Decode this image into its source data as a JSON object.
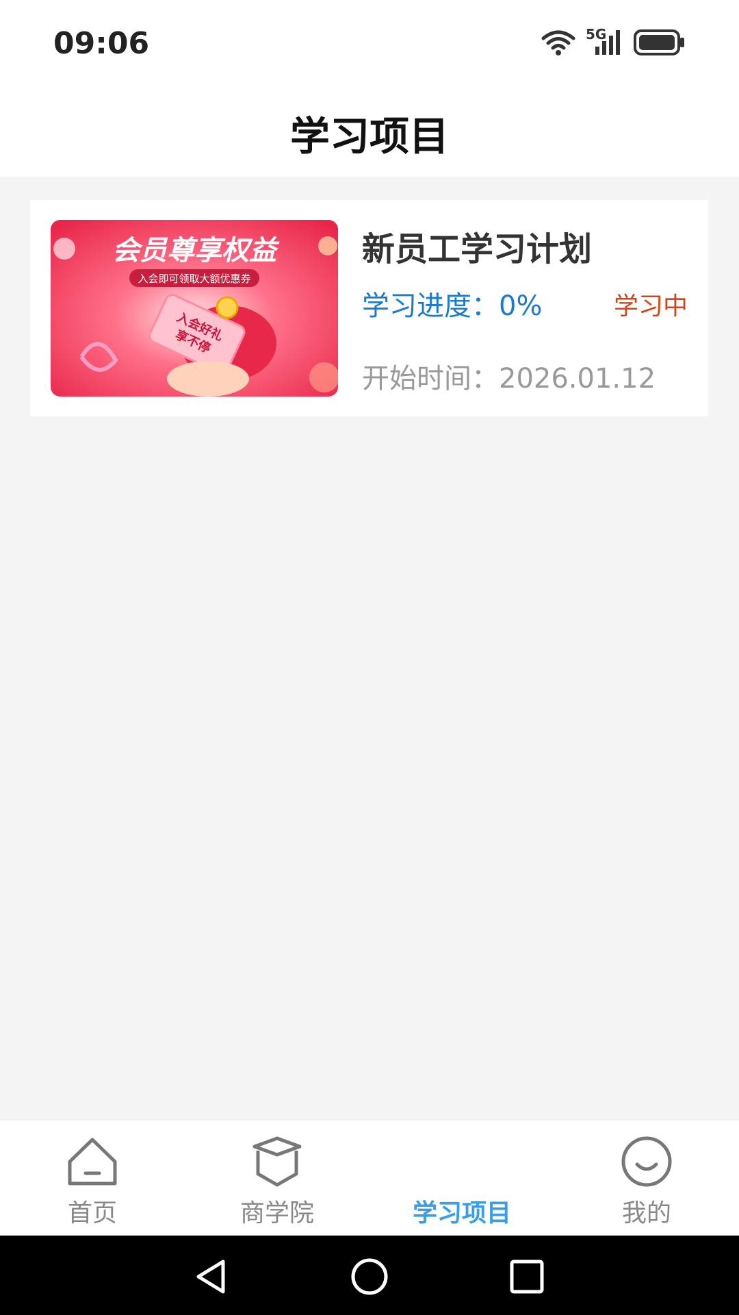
{
  "status_bar": {
    "time": "09:06",
    "network": "5G",
    "icons": [
      "wifi-icon",
      "signal-icon",
      "battery-icon"
    ]
  },
  "header": {
    "title": "学习项目"
  },
  "project_card": {
    "title": "新员工学习计划",
    "progress_label": "学习进度：0%",
    "progress_percent": 0,
    "status": "学习中",
    "start_time_label": "开始时间：2026.01.12",
    "banner": {
      "headline": "会员尊享权益",
      "subline": "入会即可领取大额优惠券",
      "coupon_line1": "入会好礼",
      "coupon_line2": "享不停"
    }
  },
  "tabbar": {
    "items": [
      {
        "label": "首页",
        "icon": "home-icon",
        "active": false
      },
      {
        "label": "商学院",
        "icon": "academy-icon",
        "active": false
      },
      {
        "label": "学习项目",
        "icon": "",
        "active": true
      },
      {
        "label": "我的",
        "icon": "smile-icon",
        "active": false
      }
    ]
  },
  "system_nav": {
    "buttons": [
      "back-icon",
      "home-circle-icon",
      "recents-icon"
    ]
  },
  "colors": {
    "accent_blue": "#1a7ad0",
    "tab_active": "#3a9de8",
    "status_red": "#d84315",
    "banner_red": "#f0405a"
  }
}
